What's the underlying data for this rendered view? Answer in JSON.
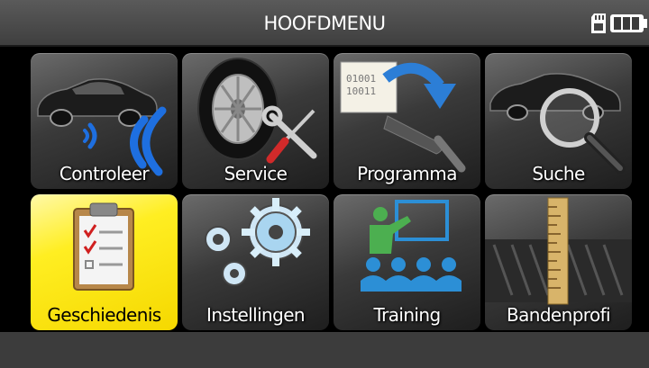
{
  "header": {
    "title": "HOOFDMENU",
    "sd_icon": "sd-card-icon",
    "battery_icon": "battery-icon"
  },
  "menu": {
    "selected_index": 4,
    "items": [
      {
        "label": "Controleer",
        "icon": "car-sensor-signal-icon"
      },
      {
        "label": "Service",
        "icon": "tire-tools-icon"
      },
      {
        "label": "Programma",
        "icon": "sensor-programming-icon"
      },
      {
        "label": "Suche",
        "icon": "car-magnifier-icon"
      },
      {
        "label": "Geschiedenis",
        "icon": "clipboard-checklist-icon"
      },
      {
        "label": "Instellingen",
        "icon": "gears-icon"
      },
      {
        "label": "Training",
        "icon": "classroom-icon"
      },
      {
        "label": "Bandenprofi",
        "icon": "tread-depth-icon"
      }
    ]
  },
  "colors": {
    "selected_tile": "#ffee22",
    "tile_dark": "#2a2a2a",
    "title_bar": "#4a4a4a",
    "status_bar": "#3c3c3c"
  }
}
